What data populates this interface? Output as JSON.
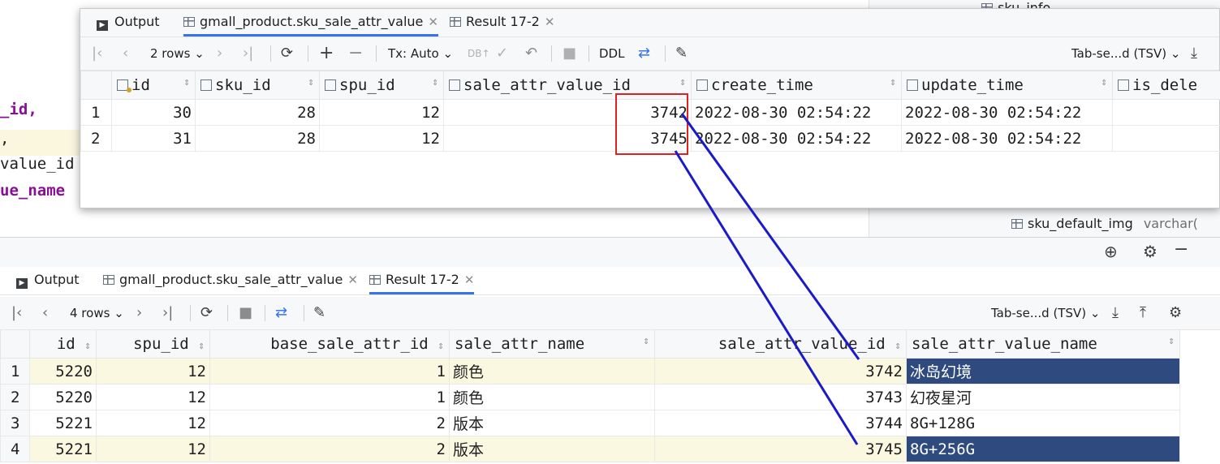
{
  "background_code": {
    "fragments": [
      "_id,",
      ",",
      "value_id",
      "ue_name"
    ]
  },
  "right_panel": {
    "top_item": "sku_info",
    "bottom_item": "sku_default_img",
    "bottom_type": "varchar("
  },
  "top_window": {
    "tabs": [
      {
        "label": "Output"
      },
      {
        "label": "gmall_product.sku_sale_attr_value"
      },
      {
        "label": "Result 17-2"
      }
    ],
    "toolbar": {
      "rows": "2 rows",
      "tx": "Tx: Auto",
      "ddl": "DDL",
      "format": "Tab-se...d (TSV)"
    },
    "columns": [
      "id",
      "sku_id",
      "spu_id",
      "sale_attr_value_id",
      "create_time",
      "update_time",
      "is_dele"
    ],
    "rows": [
      {
        "n": "1",
        "id": "30",
        "sku_id": "28",
        "spu_id": "12",
        "sale_attr_value_id": "3742",
        "create_time": "2022-08-30 02:54:22",
        "update_time": "2022-08-30 02:54:22"
      },
      {
        "n": "2",
        "id": "31",
        "sku_id": "28",
        "spu_id": "12",
        "sale_attr_value_id": "3745",
        "create_time": "2022-08-30 02:54:22",
        "update_time": "2022-08-30 02:54:22"
      }
    ]
  },
  "bottom_panel": {
    "tabs": [
      {
        "label": "Output"
      },
      {
        "label": "gmall_product.sku_sale_attr_value"
      },
      {
        "label": "Result 17-2"
      }
    ],
    "toolbar": {
      "rows": "4 rows",
      "format": "Tab-se...d (TSV)"
    },
    "columns": [
      "id",
      "spu_id",
      "base_sale_attr_id",
      "sale_attr_name",
      "sale_attr_value_id",
      "sale_attr_value_name"
    ],
    "rows": [
      {
        "n": "1",
        "id": "5220",
        "spu_id": "12",
        "base_sale_attr_id": "1",
        "sale_attr_name": "颜色",
        "sale_attr_value_id": "3742",
        "sale_attr_value_name": "冰岛幻境"
      },
      {
        "n": "2",
        "id": "5220",
        "spu_id": "12",
        "base_sale_attr_id": "1",
        "sale_attr_name": "颜色",
        "sale_attr_value_id": "3743",
        "sale_attr_value_name": "幻夜星河"
      },
      {
        "n": "3",
        "id": "5221",
        "spu_id": "12",
        "base_sale_attr_id": "2",
        "sale_attr_name": "版本",
        "sale_attr_value_id": "3744",
        "sale_attr_value_name": "8G+128G"
      },
      {
        "n": "4",
        "id": "5221",
        "spu_id": "12",
        "base_sale_attr_id": "2",
        "sale_attr_name": "版本",
        "sale_attr_value_id": "3745",
        "sale_attr_value_name": "8G+256G"
      }
    ]
  },
  "colors": {
    "accent": "#3574f0",
    "selection": "#2e4a7f",
    "annotation_box": "#dd2222",
    "annotation_arrow": "#1a1ac8",
    "row_highlight": "#fbf8e2"
  }
}
